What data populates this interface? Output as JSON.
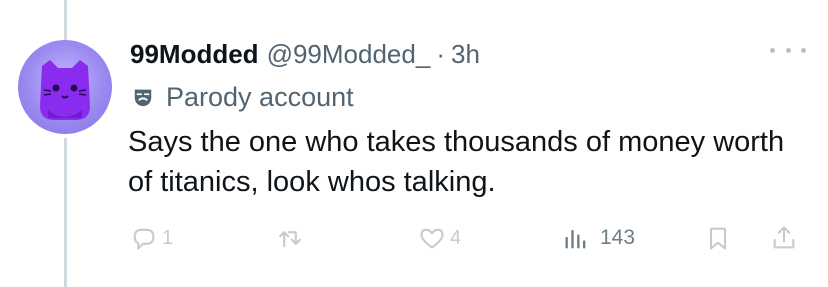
{
  "tweet": {
    "display_name": "99Modded",
    "handle": "@99Modded_",
    "separator": "·",
    "time": "3h",
    "label": "Parody account",
    "text": "Says the one who takes thousands of money worth of titanics, look whos talking.",
    "stats": {
      "replies": "1",
      "likes": "4",
      "views": "143"
    }
  },
  "icons": {
    "avatar": "purple-cat-avatar",
    "label": "theater-mask-icon",
    "more": "more-options-icon",
    "reply": "reply-icon",
    "retweet": "retweet-icon",
    "like": "heart-icon",
    "views": "views-chart-icon",
    "bookmark": "bookmark-icon",
    "share": "share-icon"
  },
  "colors": {
    "text": "#0f1419",
    "secondary": "#536471",
    "faded_icon": "#c2ccd3",
    "avatar_bg": "#9a8af0",
    "avatar_cat": "#8a2cf0"
  }
}
